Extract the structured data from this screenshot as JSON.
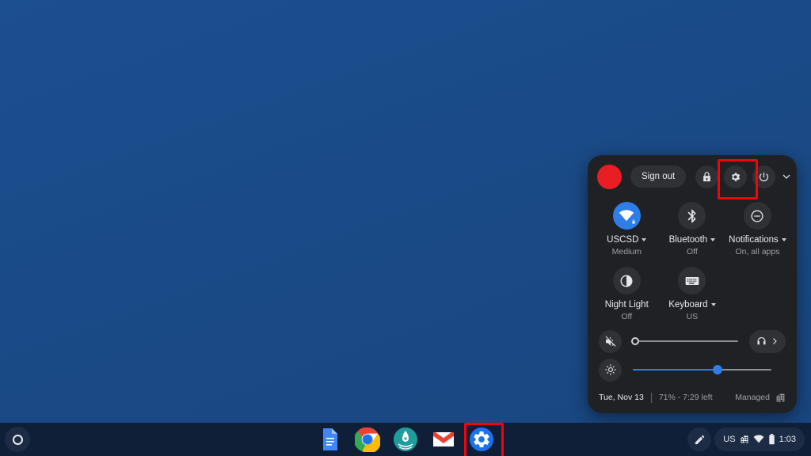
{
  "panel": {
    "account": {
      "avatar_color": "#ea1d25",
      "avatar_name": "user-avatar"
    },
    "sign_out_label": "Sign out",
    "actions": [
      {
        "name": "lock-icon",
        "label": "Lock"
      },
      {
        "name": "settings-gear-icon",
        "label": "Settings",
        "highlighted": true,
        "highlight_color": "#f3030b"
      },
      {
        "name": "power-icon",
        "label": "Power"
      },
      {
        "name": "chevron-down-icon",
        "label": "Collapse"
      }
    ],
    "tiles": [
      {
        "name": "network",
        "label": "USCSD",
        "sub": "Medium",
        "has_caret": true,
        "active": true,
        "icon": "wifi-icon"
      },
      {
        "name": "bluetooth",
        "label": "Bluetooth",
        "sub": "Off",
        "has_caret": true,
        "active": false,
        "icon": "bluetooth-icon"
      },
      {
        "name": "notifications",
        "label": "Notifications",
        "sub": "On, all apps",
        "has_caret": true,
        "active": false,
        "icon": "do-not-disturb-icon"
      },
      {
        "name": "night-light",
        "label": "Night Light",
        "sub": "Off",
        "has_caret": false,
        "active": false,
        "icon": "moon-icon"
      },
      {
        "name": "keyboard",
        "label": "Keyboard",
        "sub": "US",
        "has_caret": true,
        "active": false,
        "icon": "keyboard-icon"
      }
    ],
    "volume": {
      "name": "volume-slider",
      "value": 0,
      "muted": true,
      "icon": "volume-mute-icon",
      "output_icon": "headphones-icon"
    },
    "brightness": {
      "name": "brightness-slider",
      "value": 61,
      "icon": "brightness-icon"
    },
    "footer": {
      "date": "Tue, Nov 13",
      "battery": "71% - 7:29 left",
      "managed": "Managed",
      "managed_icon": "enterprise-icon"
    }
  },
  "shelf": {
    "launcher": {
      "name": "launcher-button",
      "icon": "circle-icon"
    },
    "apps": [
      {
        "name": "shelf-app-docs",
        "label": "Google Docs",
        "selected": false
      },
      {
        "name": "shelf-app-chrome",
        "label": "Chrome",
        "selected": false
      },
      {
        "name": "shelf-app-explore",
        "label": "Explore",
        "selected": false
      },
      {
        "name": "shelf-app-gmail",
        "label": "Gmail",
        "selected": false
      },
      {
        "name": "shelf-app-settings",
        "label": "Settings",
        "selected": true
      }
    ],
    "status": {
      "pen_icon": "stylus-icon",
      "ime": "US",
      "enterprise_icon": "enterprise-icon",
      "wifi_icon": "wifi-icon",
      "battery_icon": "battery-icon",
      "time": "1:03"
    }
  },
  "wallpaper": {
    "color": "#1a4c8b"
  }
}
